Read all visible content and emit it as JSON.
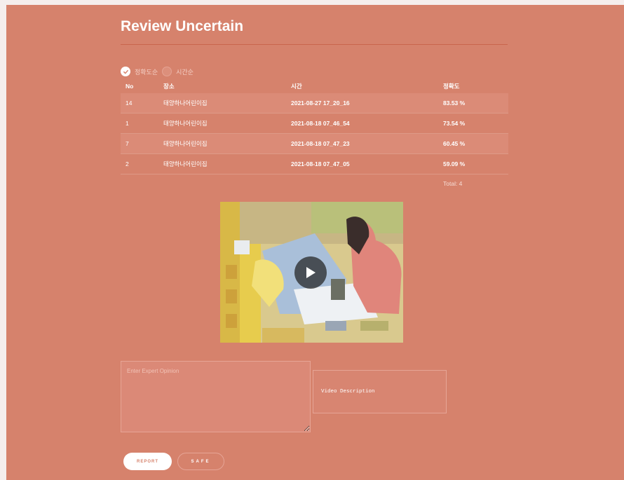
{
  "page": {
    "title": "Review Uncertain"
  },
  "sort": {
    "options": [
      {
        "label": "정확도순",
        "selected": true
      },
      {
        "label": "시간순",
        "selected": false
      }
    ]
  },
  "table": {
    "headers": {
      "no": "No",
      "place": "장소",
      "time": "시간",
      "accuracy": "정확도"
    },
    "rows": [
      {
        "no": "14",
        "place": "태양하나어린이집",
        "time": "2021-08-27 17_20_16",
        "accuracy": "83.53 %"
      },
      {
        "no": "1",
        "place": "태양하나어린이집",
        "time": "2021-08-18 07_46_54",
        "accuracy": "73.54 %"
      },
      {
        "no": "7",
        "place": "태양하나어린이집",
        "time": "2021-08-18 07_47_23",
        "accuracy": "60.45 %"
      },
      {
        "no": "2",
        "place": "태양하나어린이집",
        "time": "2021-08-18 07_47_05",
        "accuracy": "59.09 %"
      }
    ],
    "total": "Total: 4"
  },
  "video": {
    "icon": "play-icon"
  },
  "opinion": {
    "placeholder": "Enter Expert Opinion",
    "value": ""
  },
  "description": {
    "label": "Video Description"
  },
  "buttons": {
    "report": "REPORT",
    "safe": "SAFE"
  },
  "colors": {
    "panel": "#d6826c",
    "accent": "#c9664d",
    "white": "#ffffff"
  }
}
